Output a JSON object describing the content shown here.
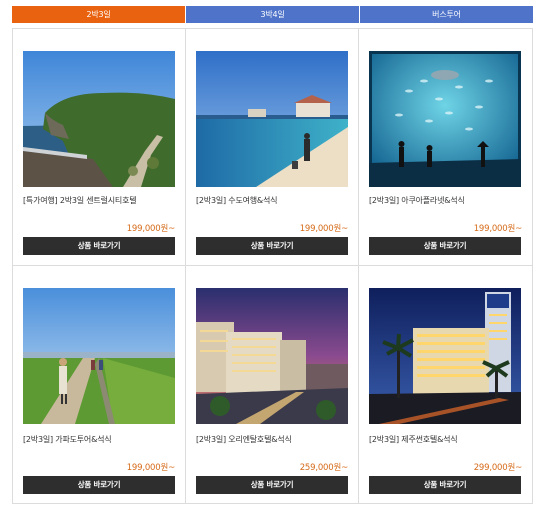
{
  "tabs": [
    {
      "label": "2박3일",
      "active": true,
      "color": "#e8620f"
    },
    {
      "label": "3박4일",
      "active": false,
      "color": "#4e73c9"
    },
    {
      "label": "버스투어",
      "active": false,
      "color": "#4e73c9"
    }
  ],
  "products": [
    {
      "title": "[특가여행] 2박3일 센트럴시티호텔",
      "price": "199,000원~",
      "button": "상품 바로가기",
      "image": "coastal-cliff-trail-photo"
    },
    {
      "title": "[2박3일] 수도여행&석식",
      "price": "199,000원~",
      "button": "상품 바로가기",
      "image": "beach-resort-photo"
    },
    {
      "title": "[2박3일] 아쿠아플라넷&석식",
      "price": "199,000원~",
      "button": "상품 바로가기",
      "image": "aquarium-tank-photo"
    },
    {
      "title": "[2박3일] 가파도투어&석식",
      "price": "199,000원~",
      "button": "상품 바로가기",
      "image": "island-walking-path-photo"
    },
    {
      "title": "[2박3일] 오리엔탈호텔&석식",
      "price": "259,000원~",
      "button": "상품 바로가기",
      "image": "hotel-city-dusk-photo"
    },
    {
      "title": "[2박3일] 제주썬호텔&석식",
      "price": "299,000원~",
      "button": "상품 바로가기",
      "image": "hotel-palm-night-photo"
    }
  ]
}
